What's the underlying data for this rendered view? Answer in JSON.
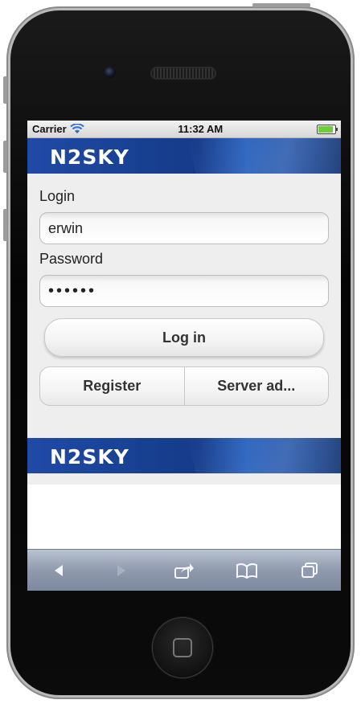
{
  "status_bar": {
    "carrier": "Carrier",
    "time": "11:32 AM"
  },
  "branding": {
    "logo_text": "N2SKY"
  },
  "login_form": {
    "login_label": "Login",
    "login_value": "erwin",
    "password_label": "Password",
    "password_value": "••••••",
    "login_button": "Log in",
    "register_button": "Register",
    "server_button": "Server ad..."
  },
  "toolbar": {
    "back_icon": "back-arrow-icon",
    "forward_icon": "forward-arrow-icon",
    "share_icon": "share-icon",
    "bookmarks_icon": "bookmarks-icon",
    "tabs_icon": "tabs-icon"
  },
  "colors": {
    "banner_blue": "#1f4aa6",
    "battery_green": "#6ccf3a",
    "toolbar": "#8f9aae"
  }
}
